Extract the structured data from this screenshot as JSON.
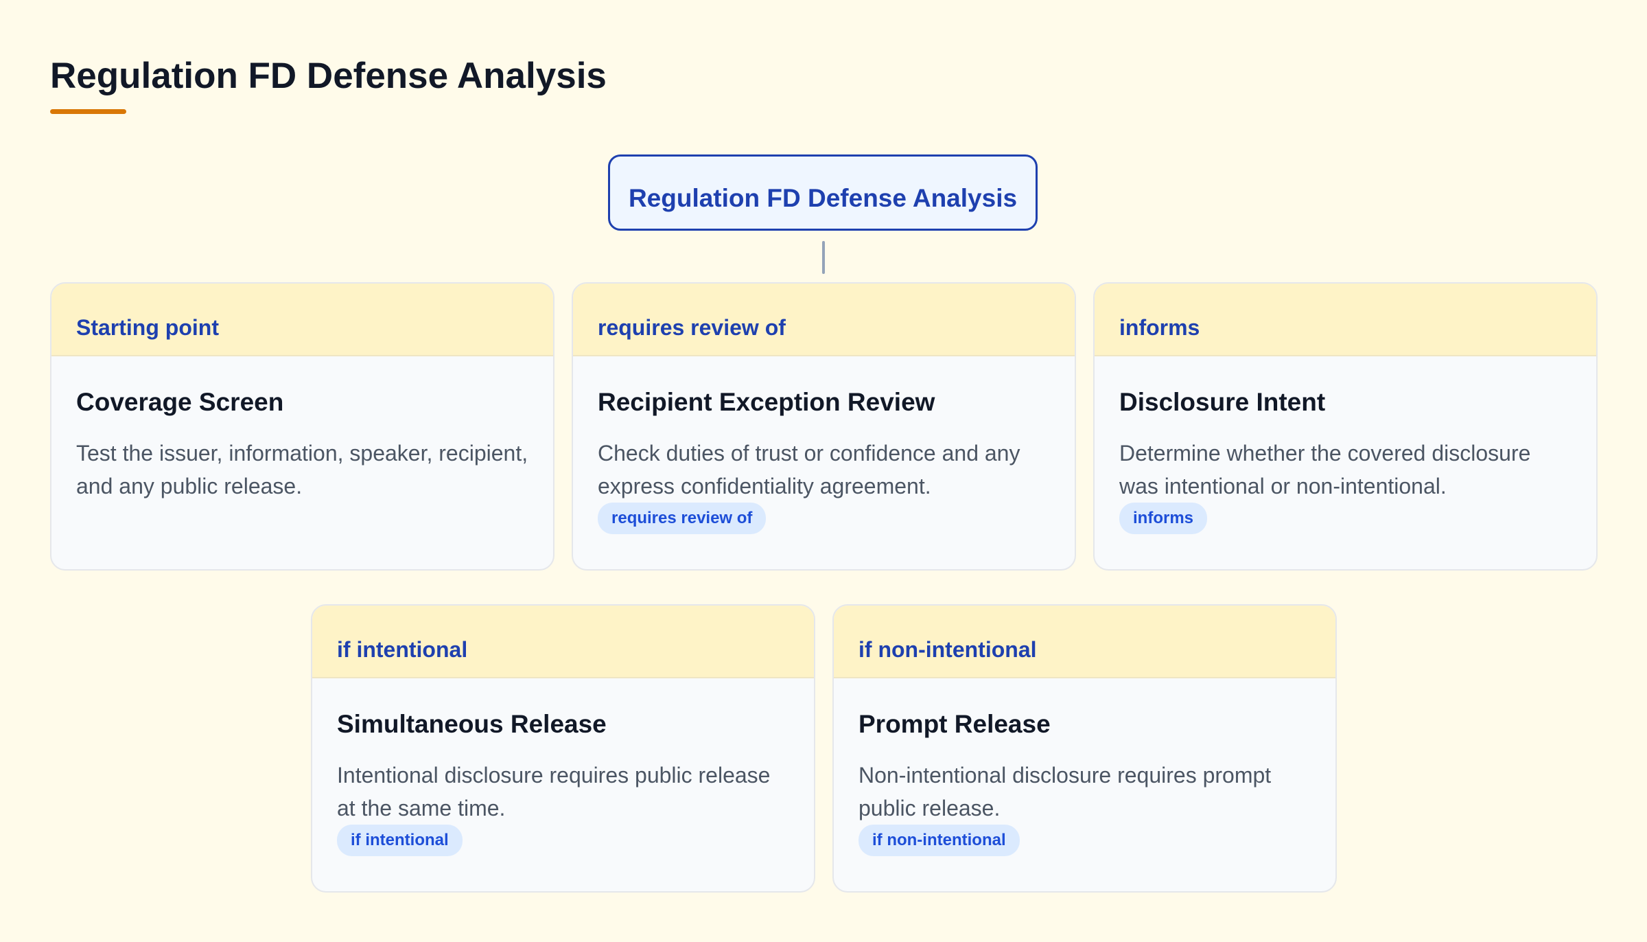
{
  "page": {
    "title": "Regulation FD Defense Analysis"
  },
  "colors": {
    "background": "#fffbea",
    "accent": "#d97706",
    "primary_blue": "#1e40af",
    "header_yellow": "#fef3c7",
    "badge_bg": "#dbeafe"
  },
  "root": {
    "label": "Regulation FD Defense Analysis"
  },
  "cards": [
    {
      "header": "Starting point",
      "title": "Coverage Screen",
      "description": "Test the issuer, information, speaker, recipient, and any public release.",
      "badge": ""
    },
    {
      "header": "requires review of",
      "title": "Recipient Exception Review",
      "description": "Check duties of trust or confidence and any express confidentiality agreement.",
      "badge": "requires review of"
    },
    {
      "header": "informs",
      "title": "Disclosure Intent",
      "description": "Determine whether the covered disclosure was intentional or non-intentional.",
      "badge": "informs"
    },
    {
      "header": "if intentional",
      "title": "Simultaneous Release",
      "description": "Intentional disclosure requires public release at the same time.",
      "badge": "if intentional"
    },
    {
      "header": "if non-intentional",
      "title": "Prompt Release",
      "description": "Non-intentional disclosure requires prompt public release.",
      "badge": "if non-intentional"
    }
  ]
}
